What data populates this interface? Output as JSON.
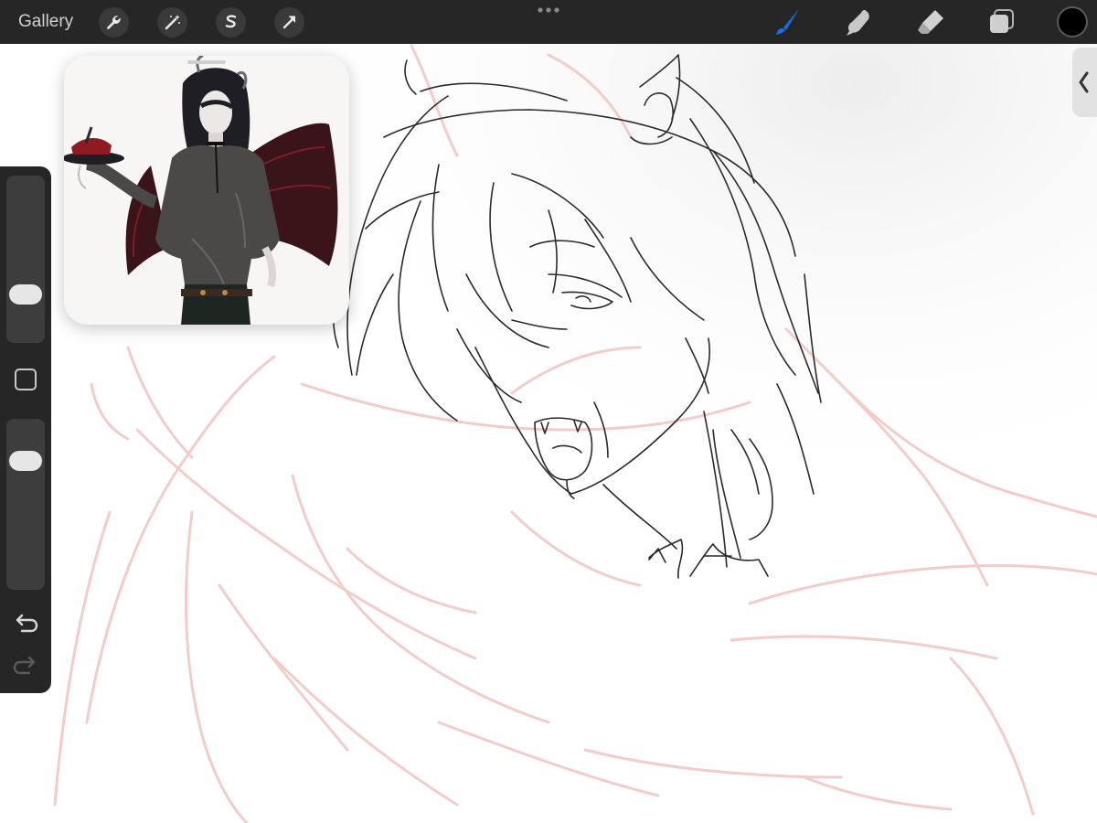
{
  "topbar": {
    "gallery_label": "Gallery",
    "left_tools": [
      "wrench-icon",
      "magic-wand-icon",
      "selection-s-icon",
      "transform-arrow-icon"
    ],
    "right_tools": [
      "brush-icon",
      "smudge-icon",
      "eraser-icon",
      "layers-icon"
    ],
    "active_tool": "brush-icon",
    "active_color": "#1a6fe8",
    "current_color": "#000000"
  },
  "sidebar": {
    "brush_size_level": 0.25,
    "opacity_level": 0.8,
    "icons": [
      "modify-square-icon",
      "undo-icon",
      "redo-icon"
    ]
  },
  "reference_window": {
    "content": "reference-image"
  },
  "colors": {
    "toolbar_bg": "#262626",
    "sketch_line": "#2a2a2a",
    "underlay_line": "#f2c4c0"
  }
}
